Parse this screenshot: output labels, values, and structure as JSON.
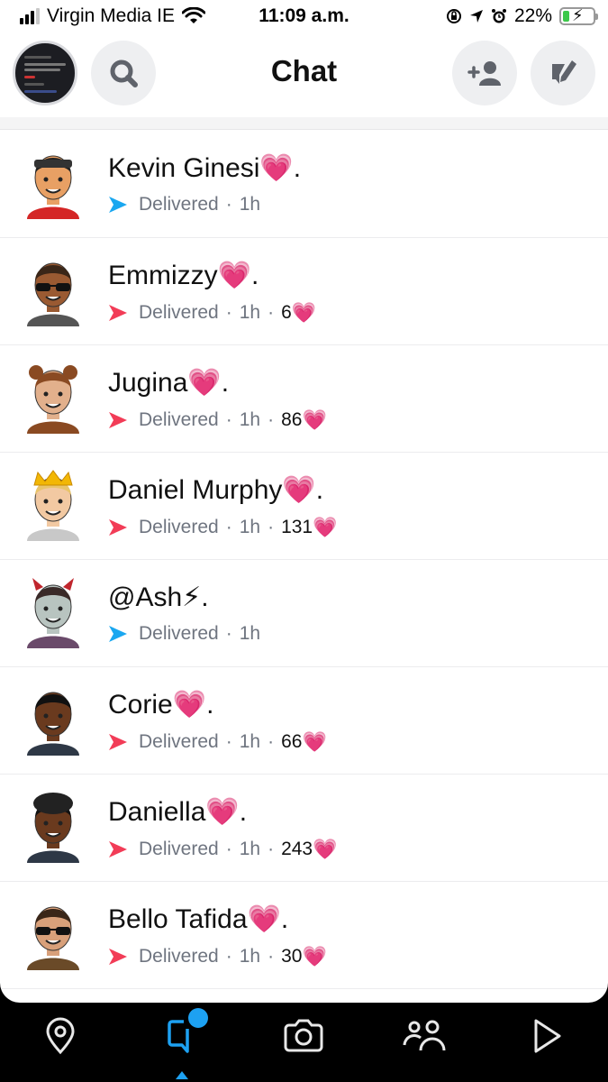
{
  "status_bar": {
    "carrier": "Virgin Media IE",
    "time": "11:09 a.m.",
    "battery": "22%",
    "battery_level": 0.22,
    "icons": [
      "signal-icon",
      "wifi-icon",
      "orientation-lock-icon",
      "location-icon",
      "alarm-icon",
      "battery-charging-icon"
    ]
  },
  "header": {
    "title": "Chat",
    "buttons": [
      "profile-avatar",
      "search-icon",
      "add-friend-icon",
      "new-chat-icon"
    ]
  },
  "colors": {
    "accent_blue": "#1da1f2",
    "sent_red": "#f23c57",
    "sent_blue": "#1aa7f0"
  },
  "chats": [
    {
      "name": "Kevin Ginesi",
      "emoji": "💗",
      "suffix": ".",
      "status": "Delivered",
      "time": "1h",
      "arrow": "blue",
      "streak": ""
    },
    {
      "name": "Emmizzy",
      "emoji": "💗",
      "suffix": ".",
      "status": "Delivered",
      "time": "1h",
      "arrow": "red",
      "streak": "6"
    },
    {
      "name": "Jugina",
      "emoji": "💗",
      "suffix": ".",
      "status": "Delivered",
      "time": "1h",
      "arrow": "red",
      "streak": "86"
    },
    {
      "name": "Daniel Murphy",
      "emoji": "💗",
      "suffix": ".",
      "status": "Delivered",
      "time": "1h",
      "arrow": "red",
      "streak": "131"
    },
    {
      "name": "@Ash",
      "emoji": "⚡",
      "suffix": ".",
      "status": "Delivered",
      "time": "1h",
      "arrow": "blue",
      "streak": ""
    },
    {
      "name": "Corie",
      "emoji": "💗",
      "suffix": ".",
      "status": "Delivered",
      "time": "1h",
      "arrow": "red",
      "streak": "66"
    },
    {
      "name": "Daniella",
      "emoji": "💗",
      "suffix": ".",
      "status": "Delivered",
      "time": "1h",
      "arrow": "red",
      "streak": "243"
    },
    {
      "name": "Bello Tafida",
      "emoji": "💗",
      "suffix": ".",
      "status": "Delivered",
      "time": "1h",
      "arrow": "red",
      "streak": "30"
    }
  ],
  "streak_emoji": "💗",
  "separator": "·",
  "bottom_nav": {
    "items": [
      "map-icon",
      "chat-icon",
      "camera-icon",
      "friends-icon",
      "discover-icon"
    ],
    "active": "chat-icon"
  }
}
